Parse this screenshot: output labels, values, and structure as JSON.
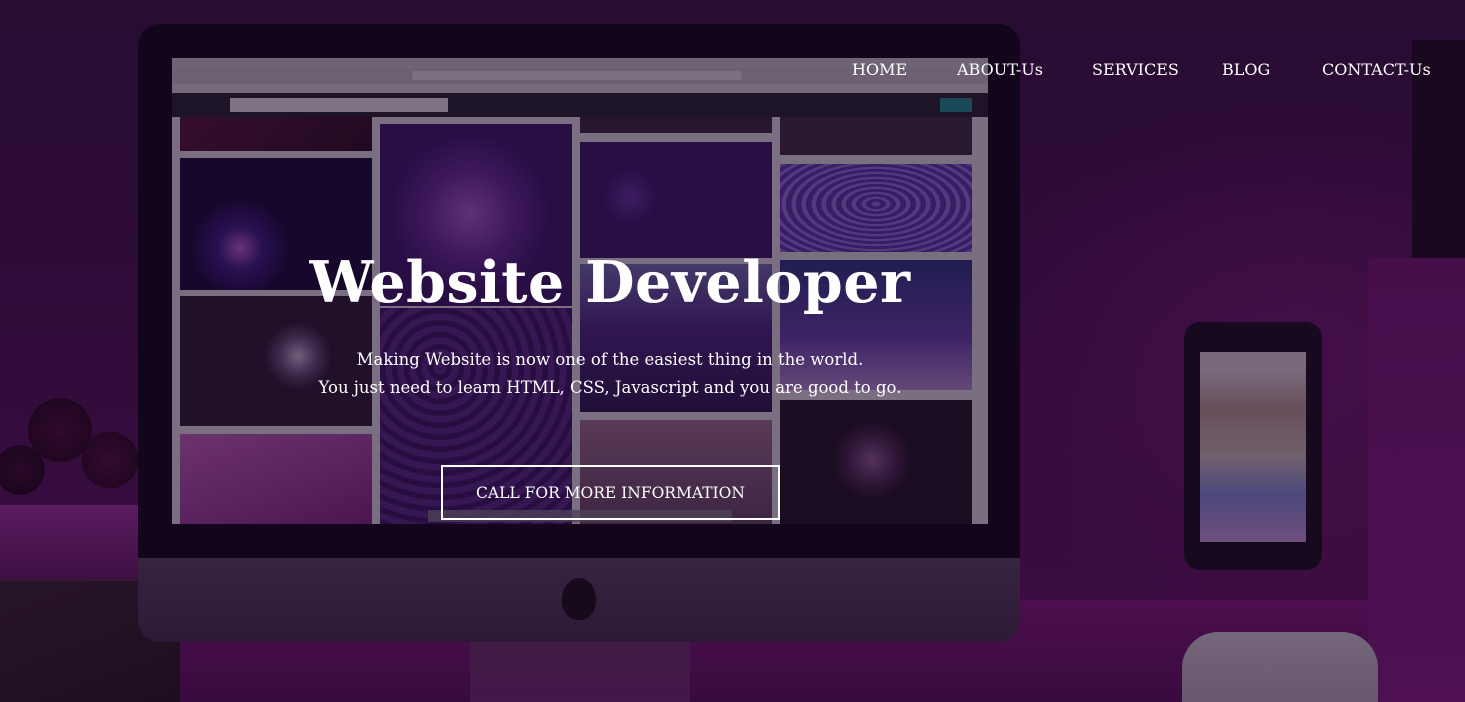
{
  "nav": {
    "items": [
      {
        "label": "HOME"
      },
      {
        "label": "ABOUT-Us"
      },
      {
        "label": "SERVICES"
      },
      {
        "label": "BLOG"
      },
      {
        "label": "CONTACT-Us"
      }
    ]
  },
  "hero": {
    "title": "Website Developer",
    "subtitle_line1": "Making Website is now one of the easiest thing in the world.",
    "subtitle_line2": "You just need to learn HTML, CSS, Javascript and you are good to go.",
    "cta_label": "CALL FOR MORE INFORMATION"
  },
  "background": {
    "description_icon": "desk-setup-photo",
    "accent_color": "#8a1584",
    "overlay_color": "#1a0622"
  }
}
